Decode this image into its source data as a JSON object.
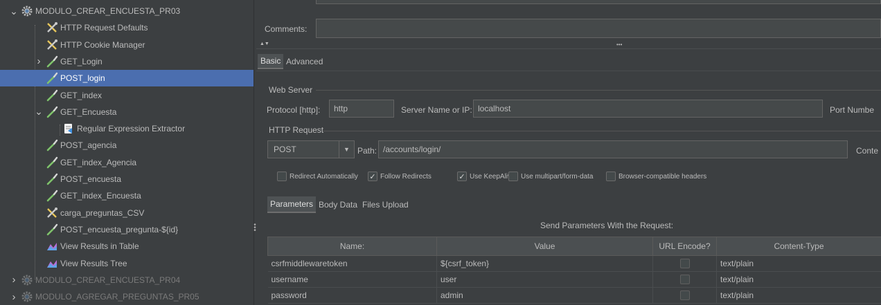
{
  "tree": {
    "items": [
      {
        "label": "MODULO_CREAR_ENCUESTA_PR03",
        "icon": "gear-icon",
        "expand": "expanded"
      },
      {
        "label": "HTTP Request Defaults",
        "icon": "wrench-icon"
      },
      {
        "label": "HTTP Cookie Manager",
        "icon": "wrench-icon"
      },
      {
        "label": "GET_Login",
        "icon": "sampler-pipette-icon",
        "expand": "collapsed"
      },
      {
        "label": "POST_login",
        "icon": "sampler-pipette-icon",
        "selected": true
      },
      {
        "label": "GET_index",
        "icon": "sampler-pipette-icon"
      },
      {
        "label": "GET_Encuesta",
        "icon": "sampler-pipette-icon",
        "expand": "expanded"
      },
      {
        "label": "Regular Expression Extractor",
        "icon": "extractor-icon"
      },
      {
        "label": "POST_agencia",
        "icon": "sampler-pipette-icon"
      },
      {
        "label": "GET_index_Agencia",
        "icon": "sampler-pipette-icon"
      },
      {
        "label": "POST_encuesta",
        "icon": "sampler-pipette-icon"
      },
      {
        "label": "GET_index_Encuesta",
        "icon": "sampler-pipette-icon"
      },
      {
        "label": "carga_preguntas_CSV",
        "icon": "wrench-icon"
      },
      {
        "label": "POST_encuesta_pregunta-${id}",
        "icon": "sampler-pipette-icon"
      },
      {
        "label": "View Results in Table",
        "icon": "listener-chart-icon"
      },
      {
        "label": "View Results Tree",
        "icon": "listener-chart-icon"
      },
      {
        "label": "MODULO_CREAR_ENCUESTA_PR04",
        "icon": "gear-icon",
        "expand": "collapsed",
        "disabled": true
      },
      {
        "label": "MODULO_AGREGAR_PREGUNTAS_PR05",
        "icon": "gear-icon",
        "expand": "collapsed",
        "disabled": true
      }
    ]
  },
  "panel": {
    "comments_label": "Comments:",
    "collapse_arrows": "▲▼",
    "divider_dots": "•••",
    "top_tabs": [
      "Basic",
      "Advanced"
    ],
    "web_server": {
      "title": "Web Server",
      "protocol_label": "Protocol [http]:",
      "protocol_value": "http",
      "server_label": "Server Name or IP:",
      "server_value": "localhost",
      "port_label": "Port Numbe"
    },
    "http_request": {
      "title": "HTTP Request",
      "method": "POST",
      "path_label": "Path:",
      "path_value": "/accounts/login/",
      "content_label": "Conte"
    },
    "options": [
      {
        "label": "Redirect Automatically",
        "checked": false
      },
      {
        "label": "Follow Redirects",
        "checked": true
      },
      {
        "label": "Use KeepAlive",
        "checked": true
      },
      {
        "label": "Use multipart/form-data",
        "checked": false
      },
      {
        "label": "Browser-compatible headers",
        "checked": false
      }
    ],
    "sub_tabs": [
      "Parameters",
      "Body Data",
      "Files Upload"
    ],
    "table": {
      "caption": "Send Parameters With the Request:",
      "headers": [
        "Name:",
        "Value",
        "URL Encode?",
        "Content-Type"
      ],
      "rows": [
        {
          "name": "csrfmiddlewaretoken",
          "value": "${csrf_token}",
          "encode": false,
          "type": "text/plain"
        },
        {
          "name": "username",
          "value": "user",
          "encode": false,
          "type": "text/plain"
        },
        {
          "name": "password",
          "value": "admin",
          "encode": false,
          "type": "text/plain"
        }
      ]
    }
  },
  "colors": {
    "selection": "#4b6eaf",
    "background": "#3c3f41",
    "field": "#45494a"
  }
}
